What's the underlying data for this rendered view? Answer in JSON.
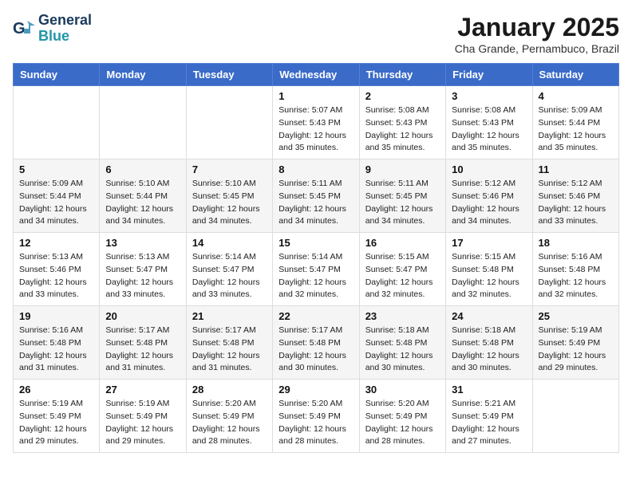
{
  "header": {
    "logo_line1": "General",
    "logo_line2": "Blue",
    "month_title": "January 2025",
    "location": "Cha Grande, Pernambuco, Brazil"
  },
  "weekdays": [
    "Sunday",
    "Monday",
    "Tuesday",
    "Wednesday",
    "Thursday",
    "Friday",
    "Saturday"
  ],
  "weeks": [
    [
      {
        "day": "",
        "info": ""
      },
      {
        "day": "",
        "info": ""
      },
      {
        "day": "",
        "info": ""
      },
      {
        "day": "1",
        "info": "Sunrise: 5:07 AM\nSunset: 5:43 PM\nDaylight: 12 hours\nand 35 minutes."
      },
      {
        "day": "2",
        "info": "Sunrise: 5:08 AM\nSunset: 5:43 PM\nDaylight: 12 hours\nand 35 minutes."
      },
      {
        "day": "3",
        "info": "Sunrise: 5:08 AM\nSunset: 5:43 PM\nDaylight: 12 hours\nand 35 minutes."
      },
      {
        "day": "4",
        "info": "Sunrise: 5:09 AM\nSunset: 5:44 PM\nDaylight: 12 hours\nand 35 minutes."
      }
    ],
    [
      {
        "day": "5",
        "info": "Sunrise: 5:09 AM\nSunset: 5:44 PM\nDaylight: 12 hours\nand 34 minutes."
      },
      {
        "day": "6",
        "info": "Sunrise: 5:10 AM\nSunset: 5:44 PM\nDaylight: 12 hours\nand 34 minutes."
      },
      {
        "day": "7",
        "info": "Sunrise: 5:10 AM\nSunset: 5:45 PM\nDaylight: 12 hours\nand 34 minutes."
      },
      {
        "day": "8",
        "info": "Sunrise: 5:11 AM\nSunset: 5:45 PM\nDaylight: 12 hours\nand 34 minutes."
      },
      {
        "day": "9",
        "info": "Sunrise: 5:11 AM\nSunset: 5:45 PM\nDaylight: 12 hours\nand 34 minutes."
      },
      {
        "day": "10",
        "info": "Sunrise: 5:12 AM\nSunset: 5:46 PM\nDaylight: 12 hours\nand 34 minutes."
      },
      {
        "day": "11",
        "info": "Sunrise: 5:12 AM\nSunset: 5:46 PM\nDaylight: 12 hours\nand 33 minutes."
      }
    ],
    [
      {
        "day": "12",
        "info": "Sunrise: 5:13 AM\nSunset: 5:46 PM\nDaylight: 12 hours\nand 33 minutes."
      },
      {
        "day": "13",
        "info": "Sunrise: 5:13 AM\nSunset: 5:47 PM\nDaylight: 12 hours\nand 33 minutes."
      },
      {
        "day": "14",
        "info": "Sunrise: 5:14 AM\nSunset: 5:47 PM\nDaylight: 12 hours\nand 33 minutes."
      },
      {
        "day": "15",
        "info": "Sunrise: 5:14 AM\nSunset: 5:47 PM\nDaylight: 12 hours\nand 32 minutes."
      },
      {
        "day": "16",
        "info": "Sunrise: 5:15 AM\nSunset: 5:47 PM\nDaylight: 12 hours\nand 32 minutes."
      },
      {
        "day": "17",
        "info": "Sunrise: 5:15 AM\nSunset: 5:48 PM\nDaylight: 12 hours\nand 32 minutes."
      },
      {
        "day": "18",
        "info": "Sunrise: 5:16 AM\nSunset: 5:48 PM\nDaylight: 12 hours\nand 32 minutes."
      }
    ],
    [
      {
        "day": "19",
        "info": "Sunrise: 5:16 AM\nSunset: 5:48 PM\nDaylight: 12 hours\nand 31 minutes."
      },
      {
        "day": "20",
        "info": "Sunrise: 5:17 AM\nSunset: 5:48 PM\nDaylight: 12 hours\nand 31 minutes."
      },
      {
        "day": "21",
        "info": "Sunrise: 5:17 AM\nSunset: 5:48 PM\nDaylight: 12 hours\nand 31 minutes."
      },
      {
        "day": "22",
        "info": "Sunrise: 5:17 AM\nSunset: 5:48 PM\nDaylight: 12 hours\nand 30 minutes."
      },
      {
        "day": "23",
        "info": "Sunrise: 5:18 AM\nSunset: 5:48 PM\nDaylight: 12 hours\nand 30 minutes."
      },
      {
        "day": "24",
        "info": "Sunrise: 5:18 AM\nSunset: 5:48 PM\nDaylight: 12 hours\nand 30 minutes."
      },
      {
        "day": "25",
        "info": "Sunrise: 5:19 AM\nSunset: 5:49 PM\nDaylight: 12 hours\nand 29 minutes."
      }
    ],
    [
      {
        "day": "26",
        "info": "Sunrise: 5:19 AM\nSunset: 5:49 PM\nDaylight: 12 hours\nand 29 minutes."
      },
      {
        "day": "27",
        "info": "Sunrise: 5:19 AM\nSunset: 5:49 PM\nDaylight: 12 hours\nand 29 minutes."
      },
      {
        "day": "28",
        "info": "Sunrise: 5:20 AM\nSunset: 5:49 PM\nDaylight: 12 hours\nand 28 minutes."
      },
      {
        "day": "29",
        "info": "Sunrise: 5:20 AM\nSunset: 5:49 PM\nDaylight: 12 hours\nand 28 minutes."
      },
      {
        "day": "30",
        "info": "Sunrise: 5:20 AM\nSunset: 5:49 PM\nDaylight: 12 hours\nand 28 minutes."
      },
      {
        "day": "31",
        "info": "Sunrise: 5:21 AM\nSunset: 5:49 PM\nDaylight: 12 hours\nand 27 minutes."
      },
      {
        "day": "",
        "info": ""
      }
    ]
  ]
}
